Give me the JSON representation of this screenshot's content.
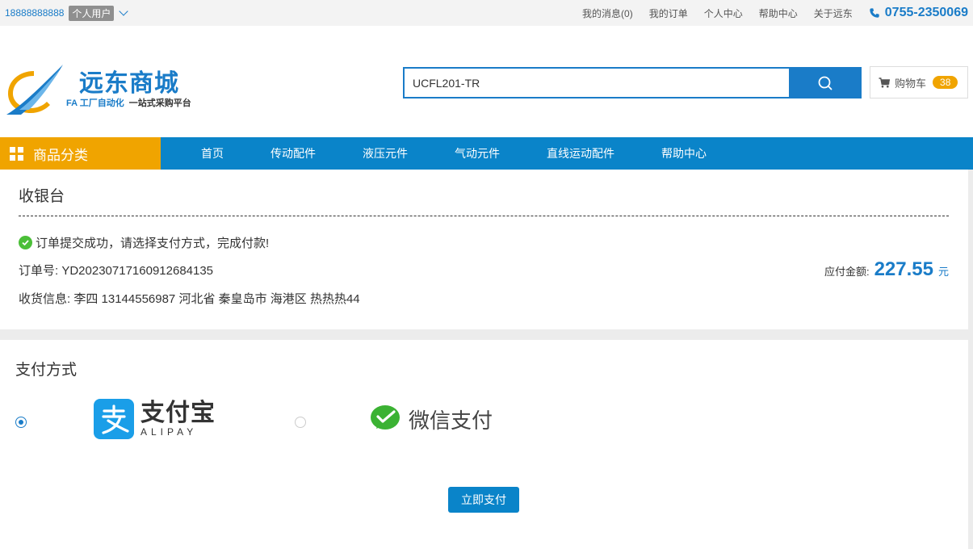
{
  "topbar": {
    "user_phone": "18888888888",
    "user_type": "个人用户",
    "links": [
      "我的消息(0)",
      "我的订单",
      "个人中心",
      "帮助中心",
      "关于远东"
    ],
    "hotline": "0755-2350069"
  },
  "header": {
    "brand": "远东商城",
    "slogan_a": "FA 工厂自动化",
    "slogan_b": "一站式采购平台",
    "search_value": "UCFL201-TR",
    "cart_label": "购物车",
    "cart_count": "38"
  },
  "nav": {
    "category_label": "商品分类",
    "items": [
      "首页",
      "传动配件",
      "液压元件",
      "气动元件",
      "直线运动配件",
      "帮助中心"
    ]
  },
  "checkout": {
    "title": "收银台",
    "success_message": "订单提交成功，请选择支付方式，完成付款!",
    "order_label": "订单号:",
    "order_no": "YD20230717160912684135",
    "receiver_label": "收货信息:",
    "receiver_info": "李四 13144556987 河北省 秦皇岛市 海港区 热热热44",
    "amount_label": "应付金额:",
    "amount": "227.55",
    "amount_unit": "元"
  },
  "payment": {
    "title": "支付方式",
    "alipay_name": "支付宝",
    "alipay_en": "ALIPAY",
    "wechat_name": "微信支付",
    "selected": "alipay",
    "pay_button": "立即支付"
  },
  "colors": {
    "primary": "#1a7cc8",
    "nav": "#0a84c9",
    "accent": "#f0a400",
    "alipay": "#1a9ee8",
    "wechat": "#3bb233",
    "success": "#4bbf38"
  }
}
